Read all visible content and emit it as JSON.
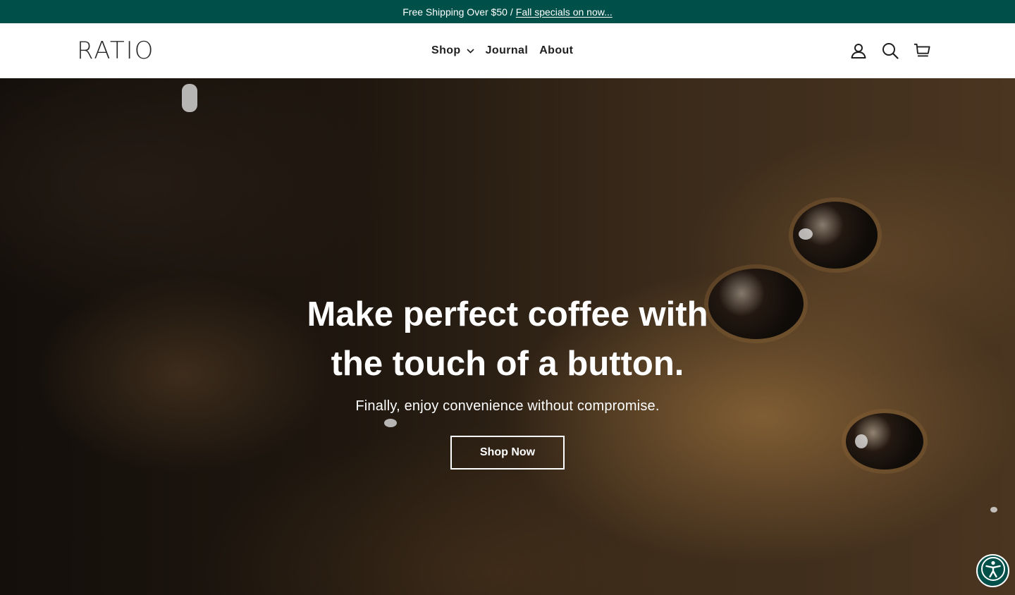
{
  "announcement": {
    "text": "Free Shipping Over $50",
    "separator": "/",
    "link_text": "Fall specials on now..."
  },
  "header": {
    "logo": "RATIO",
    "nav": [
      {
        "label": "Shop",
        "has_dropdown": true
      },
      {
        "label": "Journal"
      },
      {
        "label": "About"
      }
    ],
    "icons": [
      "account-icon",
      "search-icon",
      "cart-icon"
    ]
  },
  "hero": {
    "title": "Make perfect coffee with the touch of a button.",
    "subtitle": "Finally, enjoy convenience without compromise.",
    "button_label": "Shop Now"
  },
  "accessibility_widget": {
    "icon": "accessibility-icon"
  },
  "colors": {
    "announcement_bg": "#00504a",
    "header_bg": "#ffffff",
    "text_dark": "#1f1f1f"
  }
}
